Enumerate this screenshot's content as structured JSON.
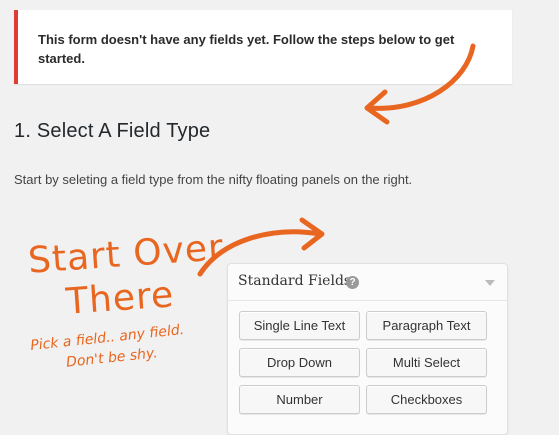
{
  "notice": {
    "text": "This form doesn't have any fields yet. Follow the steps below to get started.",
    "border_color": "#dd3d36"
  },
  "step": {
    "title": "1. Select A Field Type",
    "description": "Start by seleting a field type from the nifty floating panels on the right."
  },
  "hint": {
    "line1": "Start Over",
    "line2": "There",
    "sub1": "Pick a field.. any field.",
    "sub2": "Don't be shy.",
    "color": "#e8661f"
  },
  "panel": {
    "title": "Standard Fields",
    "help_icon": "question-circle-icon",
    "help_glyph": "?",
    "collapse_icon": "triangle-down-icon",
    "buttons": [
      "Single Line Text",
      "Paragraph Text",
      "Drop Down",
      "Multi Select",
      "Number",
      "Checkboxes"
    ]
  }
}
